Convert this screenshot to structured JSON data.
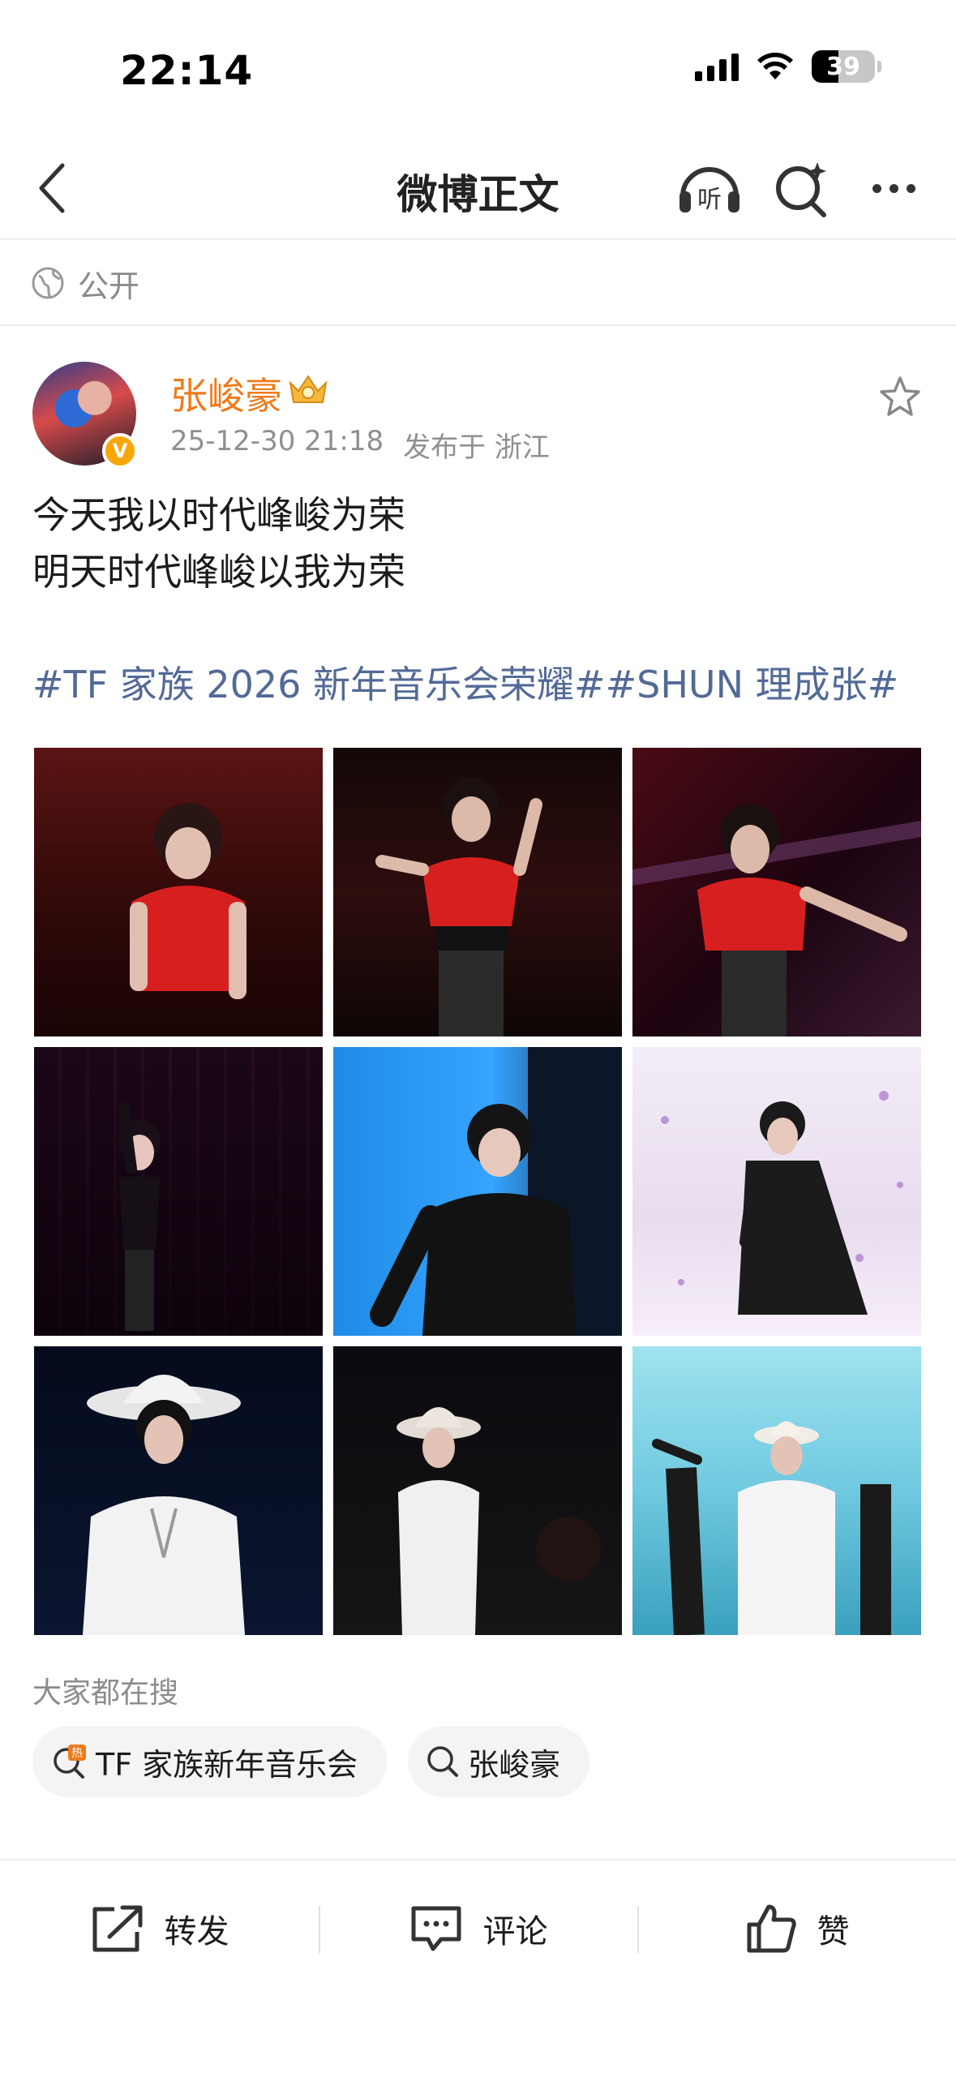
{
  "status_bar": {
    "time": "22:14",
    "battery": "39",
    "icons": [
      "signal-icon",
      "wifi-icon",
      "battery-icon"
    ]
  },
  "nav": {
    "title": "微博正文",
    "listen_label": "听",
    "icons": [
      "back-arrow-icon",
      "listen-headphones-icon",
      "search-icon",
      "more-dots-icon"
    ]
  },
  "visibility": {
    "label": "公开",
    "icon": "globe-icon"
  },
  "author": {
    "name": "张峻豪",
    "date": "25-12-30 21:18",
    "location": "发布于 浙江",
    "badge": "crown-badge-icon",
    "verified": "V",
    "accent": "#f07a19"
  },
  "post": {
    "lines": [
      "今天我以时代峰峻为荣",
      "明天时代峰峻以我为荣"
    ],
    "tags": "#TF 家族 2026 新年音乐会荣耀##SHUN 理成张#",
    "tag_color": "#536a97"
  },
  "photos": [
    "photo-1",
    "photo-2",
    "photo-3",
    "photo-4",
    "photo-5",
    "photo-6",
    "photo-7",
    "photo-8",
    "photo-9"
  ],
  "searches": {
    "heading": "大家都在搜",
    "chips": [
      {
        "label": "TF 家族新年音乐会",
        "icon": "hot-search-icon",
        "hot_badge": "热"
      },
      {
        "label": "张峻豪",
        "icon": "search-icon"
      }
    ]
  },
  "actions": [
    {
      "label": "转发",
      "icon": "share-icon"
    },
    {
      "label": "评论",
      "icon": "comment-icon"
    },
    {
      "label": "赞",
      "icon": "like-thumb-icon"
    }
  ]
}
